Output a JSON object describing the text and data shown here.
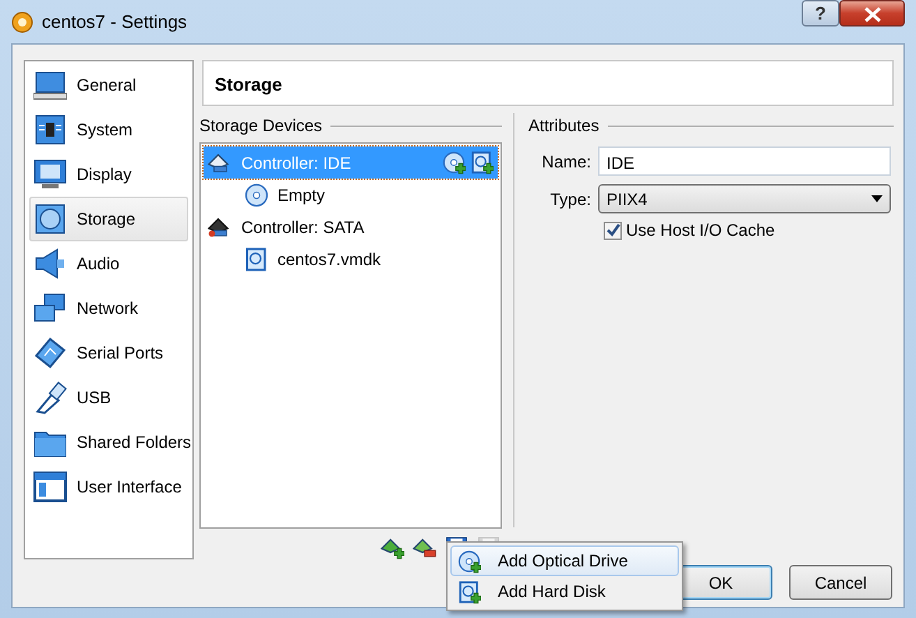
{
  "window": {
    "title": "centos7 - Settings",
    "help": "?"
  },
  "sidebar": {
    "items": [
      {
        "label": "General",
        "selected": false
      },
      {
        "label": "System",
        "selected": false
      },
      {
        "label": "Display",
        "selected": false
      },
      {
        "label": "Storage",
        "selected": true
      },
      {
        "label": "Audio",
        "selected": false
      },
      {
        "label": "Network",
        "selected": false
      },
      {
        "label": "Serial Ports",
        "selected": false
      },
      {
        "label": "USB",
        "selected": false
      },
      {
        "label": "Shared Folders",
        "selected": false
      },
      {
        "label": "User Interface",
        "selected": false
      }
    ]
  },
  "page_title": "Storage",
  "storage_devices": {
    "title": "Storage Devices",
    "tree": [
      {
        "label": "Controller: IDE",
        "kind": "ide",
        "selected": true,
        "children": [
          {
            "label": "Empty",
            "kind": "optical",
            "selected": false
          }
        ]
      },
      {
        "label": "Controller: SATA",
        "kind": "sata",
        "selected": false,
        "children": [
          {
            "label": "centos7.vmdk",
            "kind": "disk",
            "selected": false
          }
        ]
      }
    ],
    "toolbar": [
      {
        "kind": "add-controller",
        "disabled": false
      },
      {
        "kind": "remove-controller",
        "disabled": false
      },
      {
        "kind": "add-attachment",
        "disabled": false
      },
      {
        "kind": "remove-attachment",
        "disabled": true
      }
    ]
  },
  "attributes": {
    "title": "Attributes",
    "name_label": "Name:",
    "name_value": "IDE",
    "type_label": "Type:",
    "type_value": "PIIX4",
    "cache": {
      "label": "Use Host I/O Cache",
      "checked": true
    }
  },
  "popup_menu": {
    "items": [
      {
        "label": "Add Optical Drive",
        "kind": "optical",
        "selected": true
      },
      {
        "label": "Add Hard Disk",
        "kind": "disk",
        "selected": false
      }
    ]
  },
  "buttons": [
    {
      "label": "OK",
      "default": true
    },
    {
      "label": "Cancel",
      "default": false
    }
  ]
}
